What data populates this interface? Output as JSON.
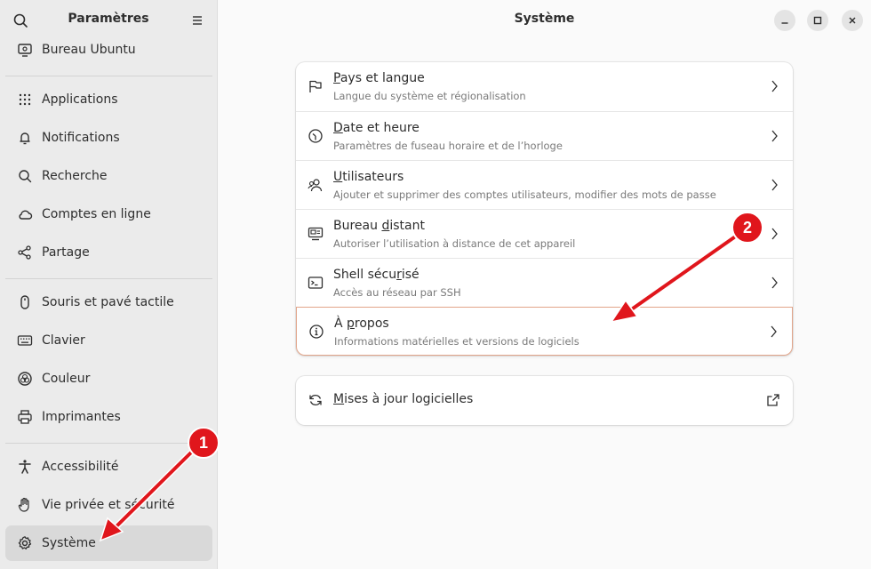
{
  "sidebar": {
    "title": "Paramètres",
    "items": [
      {
        "label": "Bureau Ubuntu",
        "icon": "desktop-icon"
      },
      {
        "label": "Applications",
        "icon": "grid-icon"
      },
      {
        "label": "Notifications",
        "icon": "bell-icon"
      },
      {
        "label": "Recherche",
        "icon": "search-icon"
      },
      {
        "label": "Comptes en ligne",
        "icon": "cloud-icon"
      },
      {
        "label": "Partage",
        "icon": "share-icon"
      },
      {
        "label": "Souris et pavé tactile",
        "icon": "mouse-icon"
      },
      {
        "label": "Clavier",
        "icon": "keyboard-icon"
      },
      {
        "label": "Couleur",
        "icon": "color-icon"
      },
      {
        "label": "Imprimantes",
        "icon": "printer-icon"
      },
      {
        "label": "Accessibilité",
        "icon": "accessibility-icon"
      },
      {
        "label": "Vie privée et sécurité",
        "icon": "hand-icon"
      },
      {
        "label": "Système",
        "icon": "gear-icon"
      }
    ]
  },
  "main": {
    "title": "Système",
    "rows": [
      {
        "title_pre": "",
        "title_ul": "P",
        "title_post": "ays et langue",
        "subtitle": "Langue du système et régionalisation",
        "icon": "flag-icon"
      },
      {
        "title_pre": "",
        "title_ul": "D",
        "title_post": "ate et heure",
        "subtitle": "Paramètres de fuseau horaire et de l’horloge",
        "icon": "clock-icon"
      },
      {
        "title_pre": "",
        "title_ul": "U",
        "title_post": "tilisateurs",
        "subtitle": "Ajouter et supprimer des comptes utilisateurs, modifier des mots de passe",
        "icon": "users-icon"
      },
      {
        "title_pre": "Bureau ",
        "title_ul": "d",
        "title_post": "istant",
        "subtitle": "Autoriser l’utilisation à distance de cet appareil",
        "icon": "remote-desktop-icon"
      },
      {
        "title_pre": "Shell sécu",
        "title_ul": "r",
        "title_post": "isé",
        "subtitle": "Accès au réseau par SSH",
        "icon": "terminal-icon"
      },
      {
        "title_pre": "À ",
        "title_ul": "p",
        "title_post": "ropos",
        "subtitle": "Informations matérielles et versions de logiciels",
        "icon": "info-icon"
      }
    ],
    "updates": {
      "title_ul": "M",
      "title_post": "ises à jour logicielles",
      "icon": "refresh-icon"
    }
  },
  "annotations": {
    "badge1": "1",
    "badge2": "2",
    "color": "#e0161c"
  }
}
